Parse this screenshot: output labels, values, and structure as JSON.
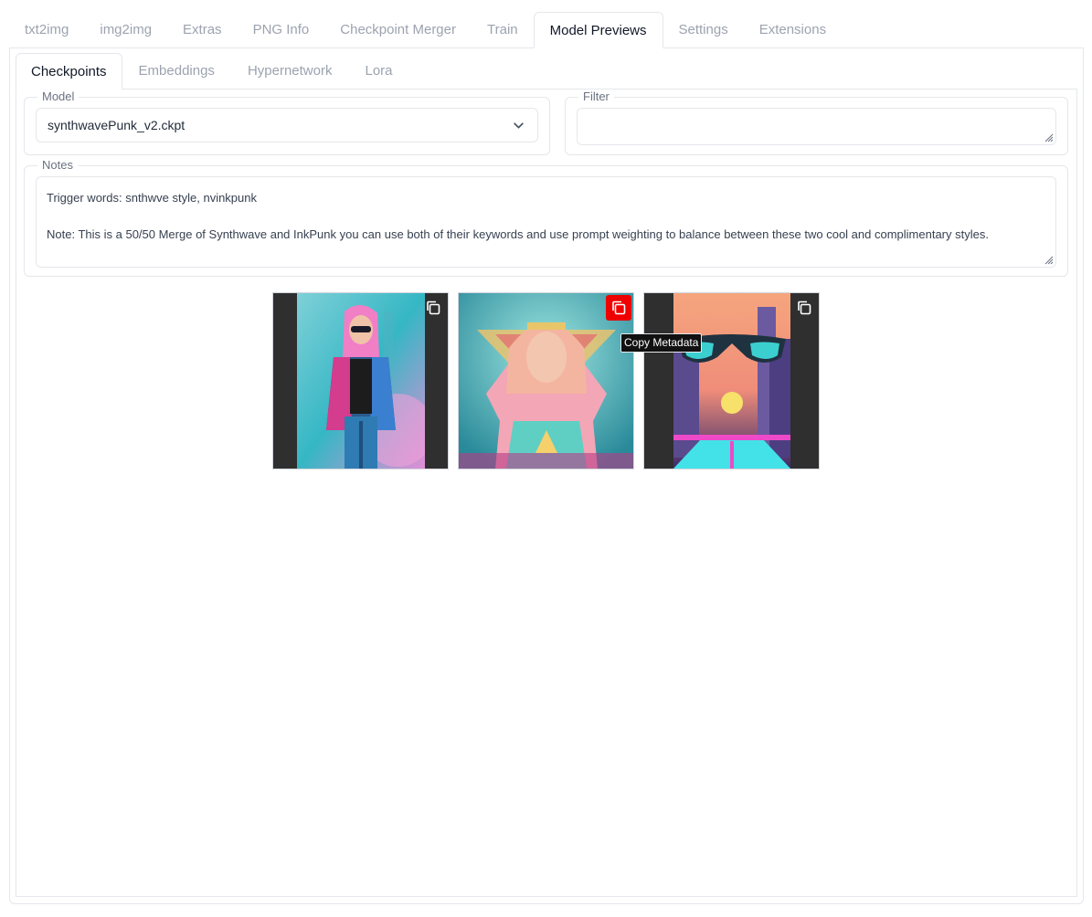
{
  "top_tabs": [
    {
      "label": "txt2img",
      "active": false
    },
    {
      "label": "img2img",
      "active": false
    },
    {
      "label": "Extras",
      "active": false
    },
    {
      "label": "PNG Info",
      "active": false
    },
    {
      "label": "Checkpoint Merger",
      "active": false
    },
    {
      "label": "Train",
      "active": false
    },
    {
      "label": "Model Previews",
      "active": true
    },
    {
      "label": "Settings",
      "active": false
    },
    {
      "label": "Extensions",
      "active": false
    }
  ],
  "sub_tabs": [
    {
      "label": "Checkpoints",
      "active": true
    },
    {
      "label": "Embeddings",
      "active": false
    },
    {
      "label": "Hypernetwork",
      "active": false
    },
    {
      "label": "Lora",
      "active": false
    }
  ],
  "model": {
    "label": "Model",
    "selected": "synthwavePunk_v2.ckpt",
    "icon": "chevron-down-icon"
  },
  "filter": {
    "label": "Filter",
    "value": ""
  },
  "notes": {
    "label": "Notes",
    "line1": "Trigger words: snthwve style, nvinkpunk",
    "line2": "Note: This is a 50/50 Merge of Synthwave and InkPunk you can use both of their keywords and use prompt weighting to balance between these two cool and complimentary styles."
  },
  "gallery": {
    "tooltip": "Copy Metadata",
    "copy_icon": "copy-icon",
    "hover_color": "#ef0000",
    "images": [
      {
        "subject": "woman in leather jacket"
      },
      {
        "subject": "woman with crown"
      },
      {
        "subject": "sunglasses city sunset"
      }
    ]
  }
}
